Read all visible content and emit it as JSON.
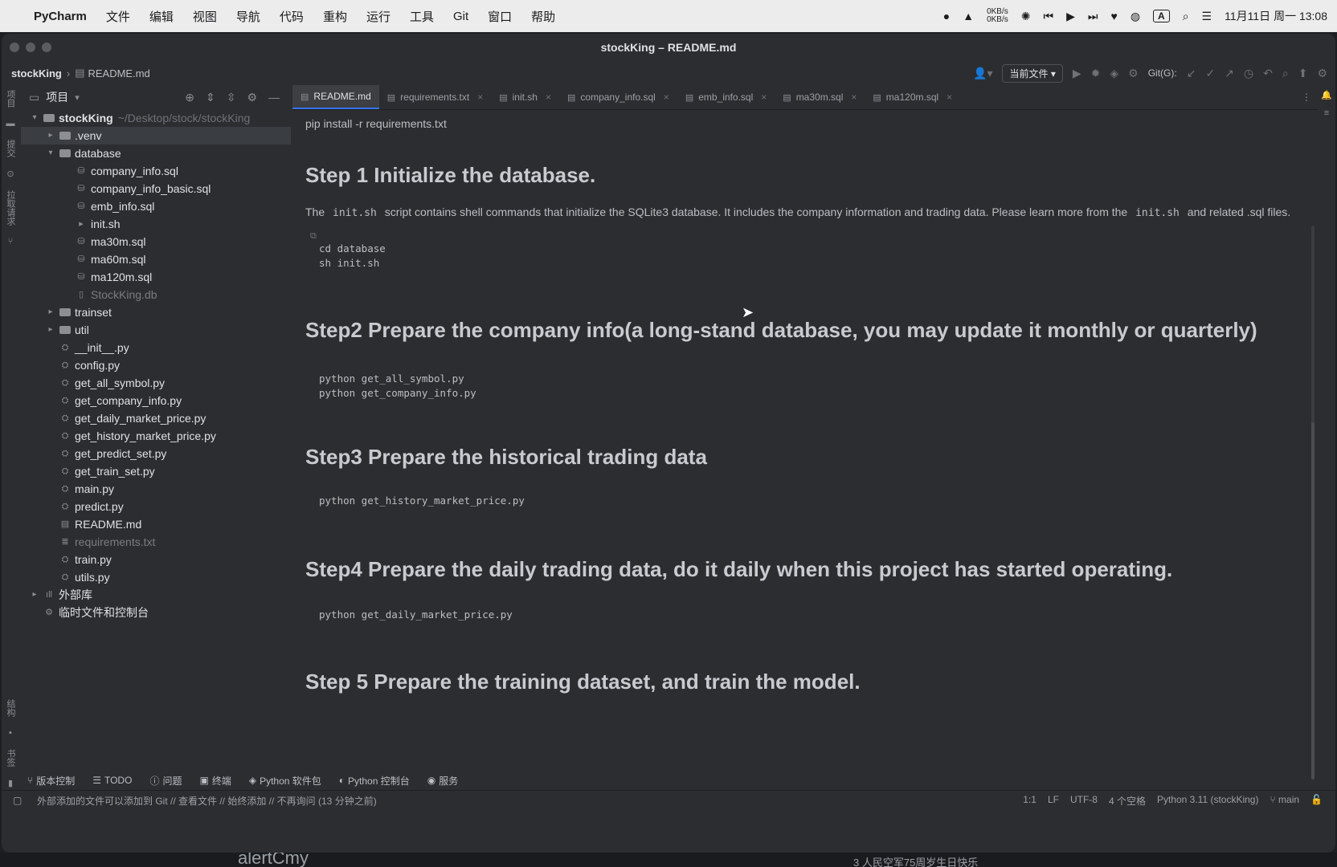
{
  "menubar": {
    "apple": "",
    "items": [
      "PyCharm",
      "文件",
      "编辑",
      "视图",
      "导航",
      "代码",
      "重构",
      "运行",
      "工具",
      "Git",
      "窗口",
      "帮助"
    ],
    "net_up": "0KB/s",
    "net_down": "0KB/s",
    "input_method": "A",
    "clock": "11月11日 周一 13:08"
  },
  "window": {
    "title": "stockKing – README.md"
  },
  "navbar": {
    "project": "stockKing",
    "file": "README.md",
    "scope_dropdown": "当前文件 ▾",
    "git_label": "Git(G):"
  },
  "left_strip": [
    "项目",
    "提交",
    "拉取请求",
    "结构",
    "书签"
  ],
  "project_panel": {
    "title": "项目",
    "tree": [
      {
        "depth": 0,
        "arrow": "⌄",
        "icon": "folder",
        "name": "stockKing",
        "path": "~/Desktop/stock/stockKing",
        "root": true
      },
      {
        "depth": 1,
        "arrow": "›",
        "icon": "folder",
        "name": ".venv",
        "dim": false,
        "selected": true
      },
      {
        "depth": 1,
        "arrow": "⌄",
        "icon": "folder",
        "name": "database"
      },
      {
        "depth": 2,
        "arrow": "",
        "icon": "sql",
        "name": "company_info.sql"
      },
      {
        "depth": 2,
        "arrow": "",
        "icon": "sql",
        "name": "company_info_basic.sql"
      },
      {
        "depth": 2,
        "arrow": "",
        "icon": "sql",
        "name": "emb_info.sql"
      },
      {
        "depth": 2,
        "arrow": "",
        "icon": "sh",
        "name": "init.sh"
      },
      {
        "depth": 2,
        "arrow": "",
        "icon": "sql",
        "name": "ma30m.sql"
      },
      {
        "depth": 2,
        "arrow": "",
        "icon": "sql",
        "name": "ma60m.sql"
      },
      {
        "depth": 2,
        "arrow": "",
        "icon": "sql",
        "name": "ma120m.sql"
      },
      {
        "depth": 2,
        "arrow": "",
        "icon": "file",
        "name": "StockKing.db",
        "dim": true
      },
      {
        "depth": 1,
        "arrow": "›",
        "icon": "folder",
        "name": "trainset"
      },
      {
        "depth": 1,
        "arrow": "›",
        "icon": "folder",
        "name": "util"
      },
      {
        "depth": 1,
        "arrow": "",
        "icon": "py",
        "name": "__init__.py"
      },
      {
        "depth": 1,
        "arrow": "",
        "icon": "py",
        "name": "config.py"
      },
      {
        "depth": 1,
        "arrow": "",
        "icon": "py",
        "name": "get_all_symbol.py"
      },
      {
        "depth": 1,
        "arrow": "",
        "icon": "py",
        "name": "get_company_info.py"
      },
      {
        "depth": 1,
        "arrow": "",
        "icon": "py",
        "name": "get_daily_market_price.py"
      },
      {
        "depth": 1,
        "arrow": "",
        "icon": "py",
        "name": "get_history_market_price.py"
      },
      {
        "depth": 1,
        "arrow": "",
        "icon": "py",
        "name": "get_predict_set.py"
      },
      {
        "depth": 1,
        "arrow": "",
        "icon": "py",
        "name": "get_train_set.py"
      },
      {
        "depth": 1,
        "arrow": "",
        "icon": "py",
        "name": "main.py"
      },
      {
        "depth": 1,
        "arrow": "",
        "icon": "py",
        "name": "predict.py"
      },
      {
        "depth": 1,
        "arrow": "",
        "icon": "md",
        "name": "README.md"
      },
      {
        "depth": 1,
        "arrow": "",
        "icon": "txt",
        "name": "requirements.txt",
        "dim": true
      },
      {
        "depth": 1,
        "arrow": "",
        "icon": "py",
        "name": "train.py"
      },
      {
        "depth": 1,
        "arrow": "",
        "icon": "py",
        "name": "utils.py"
      },
      {
        "depth": 0,
        "arrow": "›",
        "icon": "lib",
        "name": "外部库"
      },
      {
        "depth": 0,
        "arrow": "",
        "icon": "scratch",
        "name": "临时文件和控制台"
      }
    ]
  },
  "tabs": [
    {
      "label": "README.md",
      "active": true
    },
    {
      "label": "requirements.txt"
    },
    {
      "label": "init.sh"
    },
    {
      "label": "company_info.sql"
    },
    {
      "label": "emb_info.sql"
    },
    {
      "label": "ma30m.sql"
    },
    {
      "label": "ma120m.sql"
    }
  ],
  "readme": {
    "top_line": "pip install -r requirements.txt",
    "step1": {
      "heading": "Step 1 Initialize the database.",
      "p_before": "The",
      "code1": "init.sh",
      "p_mid": "script contains shell commands that initialize the SQLite3 database. It includes the company information and trading data. Please learn more from the",
      "code2": "init.sh",
      "p_after": "and related .sql files.",
      "block": "cd database\nsh init.sh"
    },
    "step2": {
      "heading": "Step2 Prepare the company info(a long-stand database, you may update it monthly or quarterly)",
      "block": "python get_all_symbol.py\npython get_company_info.py"
    },
    "step3": {
      "heading": "Step3 Prepare the historical trading data",
      "block": "python get_history_market_price.py"
    },
    "step4": {
      "heading": "Step4 Prepare the daily trading data, do it daily when this project has started operating.",
      "block": "python get_daily_market_price.py"
    },
    "step5": {
      "heading": "Step 5 Prepare the training dataset, and train the model."
    }
  },
  "toolwindows": [
    "版本控制",
    "TODO",
    "问题",
    "终端",
    "Python 软件包",
    "Python 控制台",
    "服务"
  ],
  "statusbar": {
    "message": "外部添加的文件可以添加到 Git // 查看文件 // 始终添加 // 不再询问 (13 分钟之前)",
    "position": "1:1",
    "line_sep": "LF",
    "encoding": "UTF-8",
    "indent": "4 个空格",
    "interpreter": "Python 3.11 (stockKing)",
    "branch": "main"
  },
  "bottom_peek": {
    "left": "alertCmy",
    "right": "3   人民空军75周岁生日快乐"
  }
}
